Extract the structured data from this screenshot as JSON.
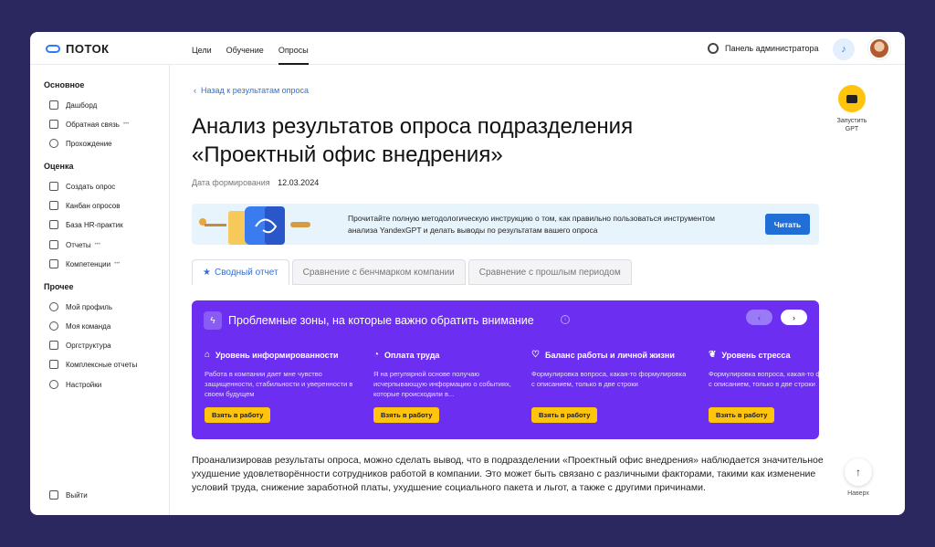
{
  "app": {
    "logo_text": "ПОТОК"
  },
  "topnav": [
    {
      "label": "Цели",
      "active": false
    },
    {
      "label": "Обучение",
      "active": false
    },
    {
      "label": "Опросы",
      "active": true
    }
  ],
  "header": {
    "admin_label": "Панель администратора",
    "bell_icon": "bell-icon",
    "avatar": "user-avatar"
  },
  "sidebar": {
    "sections": [
      {
        "title": "Основное",
        "items": [
          {
            "label": "Дашборд",
            "icon": "chart-icon",
            "dots": ""
          },
          {
            "label": "Обратная связь",
            "icon": "chat-icon",
            "dots": "•••"
          },
          {
            "label": "Прохождение",
            "icon": "play-icon",
            "dots": ""
          }
        ]
      },
      {
        "title": "Оценка",
        "items": [
          {
            "label": "Создать опрос",
            "icon": "plus-square-icon",
            "dots": ""
          },
          {
            "label": "Канбан опросов",
            "icon": "kanban-icon",
            "dots": ""
          },
          {
            "label": "База HR-практик",
            "icon": "book-icon",
            "dots": ""
          },
          {
            "label": "Отчеты",
            "icon": "report-icon",
            "dots": "•••"
          },
          {
            "label": "Компетенции",
            "icon": "competence-icon",
            "dots": "•••"
          }
        ]
      },
      {
        "title": "Прочее",
        "items": [
          {
            "label": "Мой профиль",
            "icon": "user-icon",
            "dots": ""
          },
          {
            "label": "Моя команда",
            "icon": "team-icon",
            "dots": ""
          },
          {
            "label": "Оргструктура",
            "icon": "org-icon",
            "dots": ""
          },
          {
            "label": "Комплексные отчеты",
            "icon": "complex-report-icon",
            "dots": ""
          },
          {
            "label": "Настройки",
            "icon": "gear-icon",
            "dots": ""
          }
        ]
      }
    ],
    "logout": "Выйти"
  },
  "main": {
    "back_link": "Назад к результатам опроса",
    "title": "Анализ результатов опроса подразделения «Проектный офис внедрения»",
    "date_label": "Дата формирования",
    "date_value": "12.03.2024",
    "banner": {
      "text": "Прочитайте полную методологическую инструкцию о том, как правильно пользоваться инструментом анализа YandexGPT и делать выводы по результатам вашего опроса",
      "button": "Читать"
    },
    "tabs": [
      {
        "label": "Сводный отчет",
        "active": true
      },
      {
        "label": "Сравнение с бенчмарком компании",
        "active": false
      },
      {
        "label": "Сравнение с прошлым периодом",
        "active": false
      }
    ],
    "problems": {
      "title": "Проблемные зоны, на которые важно обратить внимание",
      "cards": [
        {
          "title": "Уровень информированности",
          "icon": "gift-icon",
          "text": "Работа в компании дает мне чувство защищенности, стабильности и уверенности в своем будущем",
          "button": "Взять в работу"
        },
        {
          "title": "Оплата труда",
          "icon": "piggy-bank-icon",
          "text": "Я на регулярной основе получаю исчерпывающую информацию о событиях, которые происходили в...",
          "button": "Взять в работу"
        },
        {
          "title": "Баланс работы и личной жизни",
          "icon": "heart-icon",
          "text": "Формулировка вопроса, какая-то формулировка с описанием, только в две строки",
          "button": "Взять в работу"
        },
        {
          "title": "Уровень стресса",
          "icon": "leaf-icon",
          "text": "Формулировка вопроса, какая-то формулировка с описанием, только в две строки",
          "button": "Взять в работу"
        }
      ]
    },
    "paragraph": "Проанализировав результаты опроса, можно сделать вывод, что в подразделении «Проектный офис внедрения» наблюдается значительное ухудшение удовлетворённости сотрудников работой в компании. Это может быть связано с различными факторами, такими как изменение условий труда, снижение заработной платы, ухудшение социального пакета и льгот, а также с другими причинами."
  },
  "right": {
    "gpt_label_1": "Запустить",
    "gpt_label_2": "GPT",
    "to_top": "Наверх"
  },
  "colors": {
    "accent": "#1f6fd6",
    "purple": "#6c2ef0",
    "yellow": "#ffc40d",
    "frame": "#2b2860"
  }
}
